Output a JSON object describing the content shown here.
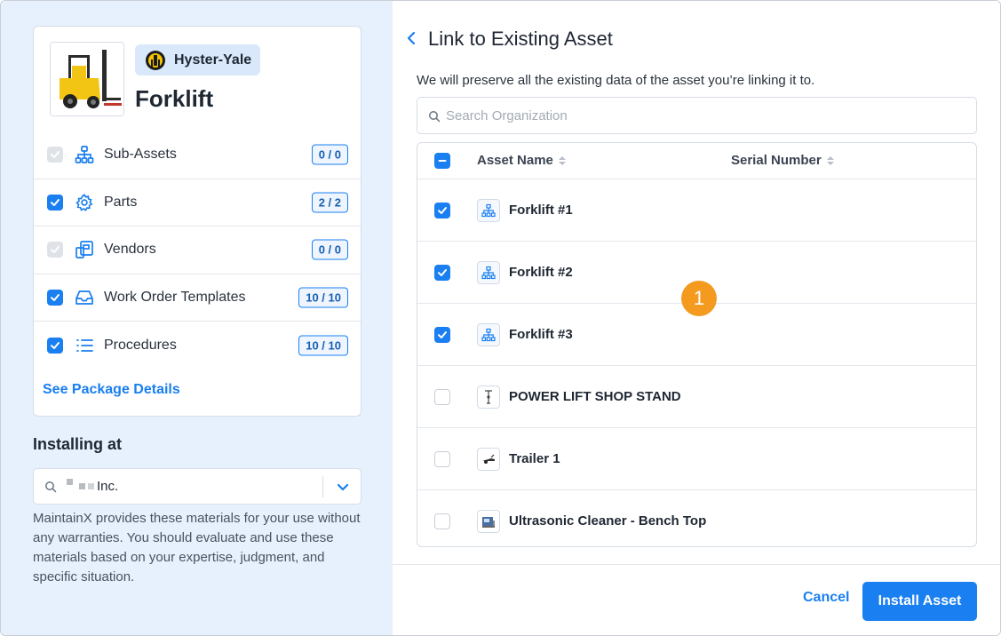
{
  "package": {
    "brand": "Hyster-Yale",
    "title": "Forklift",
    "includes": [
      {
        "label": "Sub-Assets",
        "count": "0 / 0",
        "state": "disabled",
        "icon": "sub-assets-icon"
      },
      {
        "label": "Parts",
        "count": "2 / 2",
        "state": "checked",
        "icon": "gear-icon"
      },
      {
        "label": "Vendors",
        "count": "0 / 0",
        "state": "disabled",
        "icon": "vendor-icon"
      },
      {
        "label": "Work Order Templates",
        "count": "10 / 10",
        "state": "checked",
        "icon": "inbox-tray-icon"
      },
      {
        "label": "Procedures",
        "count": "10 / 10",
        "state": "checked",
        "icon": "list-icon"
      }
    ],
    "details_link": "See Package Details"
  },
  "installing": {
    "label": "Installing at",
    "org_suffix": "Inc.",
    "disclaimer": "MaintainX provides these materials for your use without any warranties. You should evaluate and use these materials based on your expertise, judgment, and specific situation."
  },
  "link": {
    "title": "Link to Existing Asset",
    "subtitle": "We will preserve all the existing data of the asset you’re linking it to.",
    "search_placeholder": "Search Organization",
    "columns": {
      "name": "Asset Name",
      "serial": "Serial Number"
    },
    "assets": [
      {
        "name": "Forklift #1",
        "checked": true,
        "icon": "hierarchy-icon"
      },
      {
        "name": "Forklift #2",
        "checked": true,
        "icon": "hierarchy-icon"
      },
      {
        "name": "Forklift #3",
        "checked": true,
        "icon": "hierarchy-icon"
      },
      {
        "name": "POWER LIFT SHOP STAND",
        "checked": false,
        "icon": "stand-thumbnail"
      },
      {
        "name": "Trailer 1",
        "checked": false,
        "icon": "trailer-thumbnail"
      },
      {
        "name": "Ultrasonic Cleaner - Bench Top",
        "checked": false,
        "icon": "cleaner-thumbnail"
      }
    ]
  },
  "marker": "1",
  "footer": {
    "cancel": "Cancel",
    "install": "Install Asset"
  },
  "colors": {
    "accent": "#1a7ff0",
    "marker": "#f39a1f",
    "left_bg": "#e6f1fd"
  }
}
